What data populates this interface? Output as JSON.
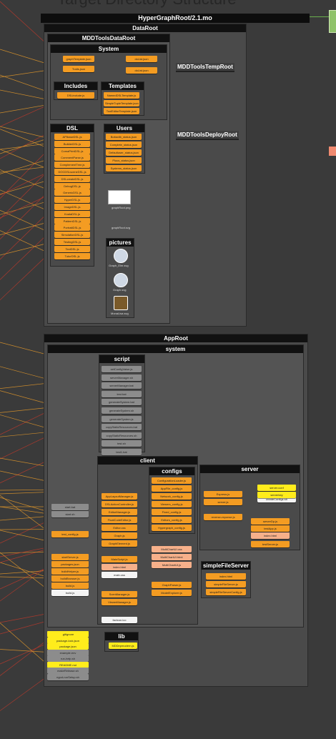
{
  "title": "Target Directory Structure",
  "root": "HyperGraphRoot/2.1.mo",
  "containers": {
    "dataroot": "DataRoot",
    "mddtoolsdataroot": "MDDToolsDataRoot",
    "system_data": "System",
    "includes": "Includes",
    "templates": "Templates",
    "dsl": "DSL",
    "users": "Users",
    "pictures": "pictures",
    "temproot": "MDDToolsTempRoot",
    "deployroot": "MDDToolsDeployRoot",
    "approot": "AppRoot",
    "system_app": "system",
    "script": "script",
    "client": "client",
    "configs": "configs",
    "server": "server",
    "simplefileserver": "simpleFileServer",
    "lib": "lib"
  },
  "colors": {
    "orange": "#f49c22",
    "yellow": "#ffec1c",
    "gray": "#8c8c8c",
    "edge_red": "#c0392b",
    "edge_orange": "#e69a2a"
  },
  "files": {
    "system": [
      "graphTemplate.json",
      "Traits.json",
      "doList.json",
      "doList.json"
    ],
    "includes": [
      "DSLinclude.js"
    ],
    "templates": [
      "NamedDSLTemplate.js",
      "SimpleTupleTemplate.json",
      "ToolEditorTemplate.json"
    ],
    "dsl": [
      "APIbaseDSL.js",
      "BuilderDSL.js",
      "ComaPrintDSL.js",
      "CommentParse.js",
      "ComplementTree.js",
      "DOCDSLsceneDSL.js",
      "DSLcreateDSL.js",
      "DebugDSL.js",
      "GenericDSL.js",
      "HyperDSL.js",
      "ImageDSL.js",
      "KoalaDSL.js",
      "PatternDSL.js",
      "PortraitDSL.js",
      "SimulationDSL.js",
      "TestingDSL.js",
      "TextDSL.js",
      "TutorDSL.js"
    ],
    "users": [
      "Boitaxlib_status.json",
      "Complete_status.json",
      "Defaultuser_status.json",
      "Pluus_status.json",
      "Systems_status.json"
    ],
    "data_misc": [
      "graphRoot.png",
      "graphRoot.svg"
    ],
    "pictures": [
      "Graph_Elm.svg",
      "Graph.svg",
      "MonaLisa.svg"
    ],
    "script": [
      "setConfigValue.js",
      "serverManager.sh",
      "serverManager.bat",
      "test.bat",
      "generateSystem.bat",
      "generateSystem.sh",
      "generateSystem.js",
      "copyStaticResources.bat",
      "copyStaticResources.sh",
      "test.sh",
      "test1.bat"
    ],
    "client": [
      "AppLayoutManager.js",
      "DSLActionController.js",
      "EditorManager.js",
      "FloatCodeEditor.js",
      "Editor.css",
      "Graph.js",
      "GraphElement.js",
      "MainScript.js",
      "index.html",
      "main.css",
      "ScenManager.js",
      "ViewerManager.js",
      "favicon.ico"
    ],
    "configs": [
      "ConfigurationLoader.js",
      "AppFile_config.js",
      "Network_config.js",
      "Viewers_config.js",
      "Fixed_config.js",
      "Editors_config.js",
      "Hypergraph_config.js"
    ],
    "client_extra": [
      "MultiChartUI.css",
      "MultiChartUI.html",
      "MultiChartUI.js",
      "GraphParser.js",
      "ModelExplorer.js"
    ],
    "server": [
      "createConfigs.sh",
      "server.conf",
      "serverkey",
      "Express.js",
      "server.js",
      "reverse-reponse.js",
      "serverDp.js",
      "testApp.js",
      "index.html",
      "testServer.js"
    ],
    "simplefileserver": [
      "index.html",
      "simpleFileServer.js",
      "simpleFileServerConfig.js"
    ],
    "system_loose": [
      "start.bat",
      "start.sh",
      "test_config.js",
      "startServer.js",
      "packages.json",
      "buildHelper.js",
      "buildBrowser.js",
      "build.js",
      "build.js"
    ],
    "root_loose": [
      ".gitignore",
      "package-lock.json",
      "package.json",
      "example.env",
      "run-help.sh",
      "README.md",
      "makeRelease.sh",
      "ngod-runSetup.sh"
    ],
    "lib": [
      "MDDepmodern.js"
    ]
  }
}
